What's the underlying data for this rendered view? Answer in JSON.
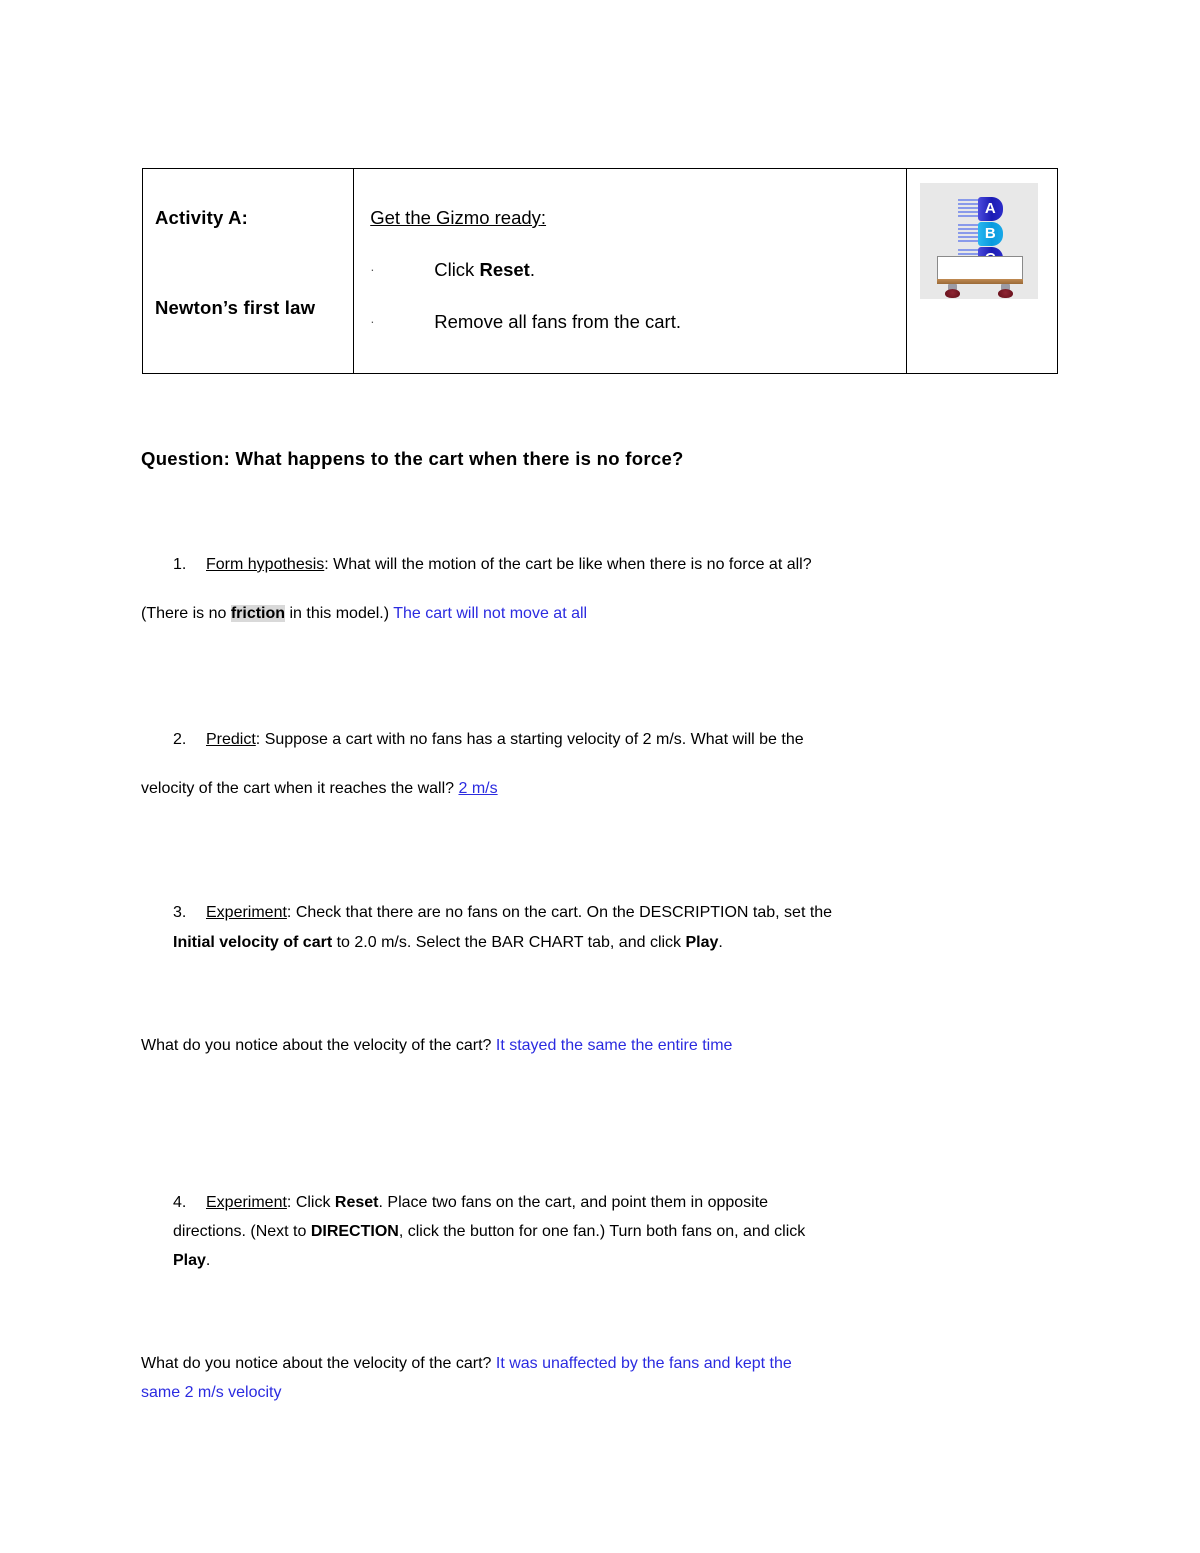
{
  "document": {
    "title": "Activity A: Newton's first law"
  },
  "activity_table": {
    "activity_label": "Activity A:",
    "activity_sublabel": "Newton’s first law",
    "ready_title": "Get the Gizmo ready",
    "ready_title_colon": ":",
    "bullet_marker": "·",
    "bullets": [
      {
        "pre": "Click ",
        "bold": "Reset",
        "post": "."
      },
      {
        "pre": "Remove all fans from the cart.",
        "bold": "",
        "post": ""
      }
    ],
    "thumbnail": {
      "alt": "cart-with-three-fans",
      "fans": [
        {
          "label": "A",
          "color": "#2b2bc8"
        },
        {
          "label": "B",
          "color": "#18a8e8"
        },
        {
          "label": "C",
          "color": "#2b2bc8"
        }
      ],
      "cart_deck_color": "#a9763f",
      "wheel_color": "#6e1520",
      "background_color": "#e8e8e8"
    }
  },
  "question_heading": "Question: What happens to the cart when there is no force?",
  "items": [
    {
      "number": "1.",
      "label": "Form hypothesis",
      "line1_rest": ": What will the motion of the cart be like when there is no force at all?",
      "line2_pre": "(There is no ",
      "line2_highlight": "friction",
      "line2_mid": " in this model.) ",
      "answer": "The cart will not move at all"
    },
    {
      "number": "2.",
      "label": "Predict",
      "line1_rest": ": Suppose a cart with no fans has a starting velocity of 2 m/s. What will be the",
      "line2_pre": "velocity of the cart when it reaches the wall? ",
      "answer": "2 m/s"
    },
    {
      "number": "3.",
      "label": "Experiment",
      "line1_rest": ": Check that there are no fans on the cart. On the DESCRIPTION tab, set the",
      "line2_bold1": "Initial velocity of cart",
      "line2_mid": " to 2.0 m/s. Select the BAR CHART tab, and click ",
      "line2_bold2": "Play",
      "line2_end": "."
    },
    {
      "number": "4.",
      "label": "Experiment",
      "line1_mid": ": Click ",
      "line1_bold": "Reset",
      "line1_rest": ". Place two fans on the cart, and point them in opposite",
      "line2_pre": "directions. (Next to ",
      "line2_bold": "DIRECTION",
      "line2_mid": ", click the  button for one fan.) Turn both fans on, and click",
      "line3_bold": "Play",
      "line3_end": "."
    }
  ],
  "notes": [
    {
      "prompt": "What do you notice about the velocity of the cart? ",
      "answer": "It stayed the same the entire time"
    },
    {
      "prompt": "What do you notice about the velocity of the cart? ",
      "answer_line1": "It was unaffected by the fans and kept the",
      "answer_line2": "same 2 m/s velocity"
    }
  ],
  "colors": {
    "answer_blue": "#2b2be0",
    "highlight_gray": "#d9d9d9",
    "border_black": "#000000"
  }
}
